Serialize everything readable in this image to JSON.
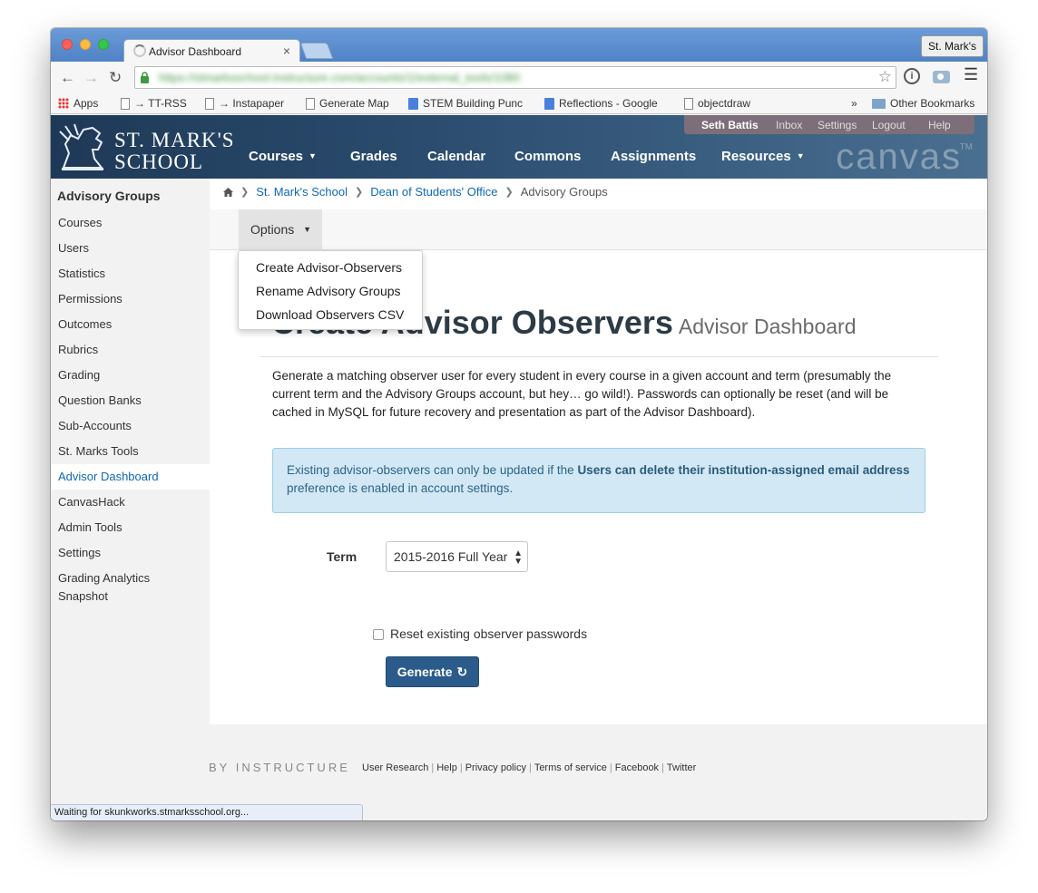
{
  "browser": {
    "tab_title": "Advisor Dashboard",
    "tab_close": "×",
    "profile_button": "St. Mark's",
    "url": "https://stmarksschool.instructure.com/accounts/1/external_tools/1080",
    "bookmarks": [
      {
        "label": "Apps",
        "icon": "apps-icon"
      },
      {
        "label": "→ TT-RSS",
        "icon": "page-icon"
      },
      {
        "label": "→ Instapaper",
        "icon": "page-icon"
      },
      {
        "label": "Generate Map",
        "icon": "page-icon"
      },
      {
        "label": "STEM Building Punc",
        "icon": "doc-icon"
      },
      {
        "label": "Reflections - Google",
        "icon": "doc-icon"
      },
      {
        "label": "objectdraw",
        "icon": "page-icon"
      }
    ],
    "bookmarks_overflow": "»",
    "other_bookmarks": "Other Bookmarks",
    "status": "Waiting for skunkworks.stmarksschool.org..."
  },
  "header": {
    "school_name_line1": "ST. MARK'S",
    "school_name_line2": "SCHOOL",
    "nav": [
      "Courses",
      "Grades",
      "Calendar",
      "Commons",
      "Assignments",
      "Resources"
    ],
    "canvas_logo": "canvas",
    "canvas_tm": "TM",
    "user_name": "Seth Battis",
    "inbox": "Inbox",
    "settings": "Settings",
    "logout": "Logout",
    "help": "Help"
  },
  "sidebar": {
    "title": "Advisory Groups",
    "items": [
      "Courses",
      "Users",
      "Statistics",
      "Permissions",
      "Outcomes",
      "Rubrics",
      "Grading",
      "Question Banks",
      "Sub-Accounts",
      "St. Marks Tools",
      "Advisor Dashboard",
      "CanvasHack",
      "Admin Tools",
      "Settings",
      "Grading Analytics Snapshot"
    ],
    "active_item": "Advisor Dashboard"
  },
  "breadcrumb": {
    "items": [
      "St. Mark's School",
      "Dean of Students' Office",
      "Advisory Groups"
    ]
  },
  "options": {
    "button_label": "Options",
    "menu_items": [
      "Create Advisor-Observers",
      "Rename Advisory Groups",
      "Download Observers CSV"
    ]
  },
  "page": {
    "title": "Create Advisor Observers",
    "subtitle": "Advisor Dashboard",
    "description": "Generate a matching observer user for every student in every course in a given account and term (presumably the current term and the Advisory Groups account, but hey… go wild!). Passwords can optionally be reset (and will be cached in MySQL for future recovery and presentation as part of the Advisor Dashboard).",
    "alert_part1": "Existing advisor-observers can only be updated if the ",
    "alert_bold": "Users can delete their institution-assigned email address",
    "alert_part2": " preference is enabled in account settings.",
    "term_label": "Term",
    "term_value": "2015-2016 Full Year",
    "reset_label": "Reset existing observer passwords",
    "generate_label": "Generate"
  },
  "footer": {
    "by_instructure": "BY INSTRUCTURE",
    "links": [
      "User Research",
      "Help",
      "Privacy policy",
      "Terms of service",
      "Facebook",
      "Twitter"
    ]
  },
  "colors": {
    "link": "#0e68b3",
    "header_bg": "#2b4c6e",
    "primary_button": "#2a5b8a",
    "alert_bg": "#d2e8f4"
  }
}
